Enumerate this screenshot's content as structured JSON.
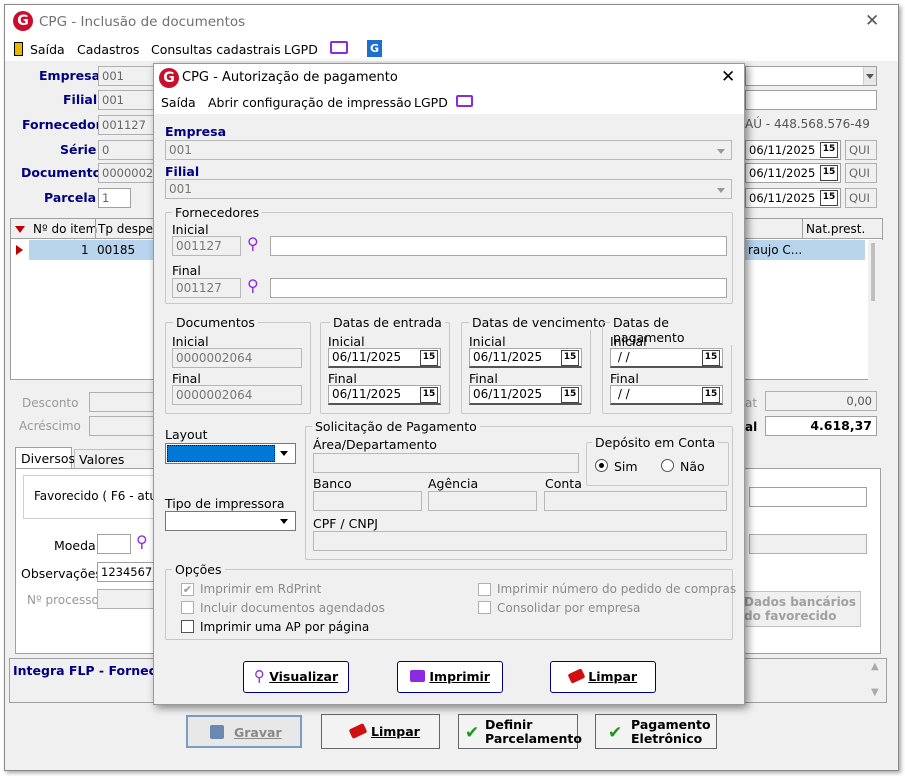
{
  "main": {
    "title": "CPG - Inclusão de documentos",
    "menu": [
      "Saída",
      "Cadastros",
      "Consultas cadastrais",
      "LGPD"
    ],
    "fields": {
      "empresa_label": "Empresa",
      "empresa_value": "001",
      "filial_label": "Filial",
      "filial_value": "001",
      "fornecedor_label": "Fornecedor",
      "fornecedor_value": "001127",
      "serie_label": "Série",
      "serie_value": "0",
      "documento_label": "Documento",
      "documento_value": "000000206",
      "parcela_label": "Parcela",
      "parcela_value": "1"
    },
    "right": {
      "fornecedor_desc": "AÚ - 448.568.576-49",
      "date1": "06/11/2025",
      "day1": "QUI",
      "date2": "06/11/2025",
      "day2": "QUI",
      "date3": "06/11/2025",
      "day3": "QUI",
      "cal": "15"
    },
    "grid": {
      "headers": [
        "Nº do item",
        "Tp despesa",
        "Nat.prest."
      ],
      "row": {
        "item": "1",
        "tp": "00185",
        "name": "raujo C..."
      }
    },
    "totals": {
      "desconto": "Desconto",
      "acrescimo": "Acréscimo",
      "total_label_at": "at",
      "total_value1": "0,00",
      "total_label_al": "al",
      "total_value2": "4.618,37"
    },
    "tabs": [
      "Diversos",
      "Valores compl"
    ],
    "tab_content": {
      "favorecido": "Favorecido ( F6 - atuali",
      "moeda": "Moeda",
      "observacoes": "Observações",
      "obs_value": "12345678",
      "processo": "Nº processo",
      "dados_bancarios": "Dados bancários\ndo favorecido"
    },
    "integra": "Integra FLP - Fornece",
    "buttons": {
      "gravar": "Gravar",
      "limpar": "Limpar",
      "definir": "Definir\nParcelamento",
      "pagamento": "Pagamento\nEletrônico"
    }
  },
  "dialog": {
    "title": "CPG - Autorização de pagamento",
    "menu": [
      "Saída",
      "Abrir configuração de impressão",
      "LGPD"
    ],
    "empresa_label": "Empresa",
    "empresa_value": "001",
    "filial_label": "Filial",
    "filial_value": "001",
    "fornecedores": {
      "group": "Fornecedores",
      "inicial": "Inicial",
      "inicial_value": "001127",
      "final": "Final",
      "final_value": "001127"
    },
    "documentos": {
      "group": "Documentos",
      "inicial": "Inicial",
      "inicial_value": "0000002064",
      "final": "Final",
      "final_value": "0000002064"
    },
    "entrada": {
      "group": "Datas de entrada",
      "inicial": "Inicial",
      "inicial_value": "06/11/2025",
      "final": "Final",
      "final_value": "06/11/2025"
    },
    "vencimento": {
      "group": "Datas de vencimento",
      "inicial": "Inicial",
      "inicial_value": "06/11/2025",
      "final": "Final",
      "final_value": "06/11/2025"
    },
    "pagamento": {
      "group": "Datas de pagamento",
      "inicial": "Inicial",
      "inicial_value": " / /",
      "final": "Final",
      "final_value": " / /"
    },
    "cal": "15",
    "layout_label": "Layout",
    "tipo_impressora_label": "Tipo de impressora",
    "solicitacao": {
      "group": "Solicitação de Pagamento",
      "area": "Área/Departamento",
      "banco": "Banco",
      "agencia": "Agência",
      "conta": "Conta",
      "cpf": "CPF / CNPJ"
    },
    "deposito": {
      "group": "Depósito em Conta",
      "sim": "Sim",
      "nao": "Não"
    },
    "opcoes": {
      "group": "Opções",
      "o1": "Imprimir em RdPrint",
      "o2": "Incluir documentos agendados",
      "o3": "Imprimir uma AP por página",
      "o4": "Imprimir número do pedido de compras",
      "o5": "Consolidar por empresa"
    },
    "buttons": {
      "visualizar": "Visualizar",
      "imprimir": "Imprimir",
      "limpar": "Limpar"
    }
  },
  "colors": {
    "accent": "#000080",
    "brand": "#c8102e",
    "selection": "#0078d7"
  }
}
